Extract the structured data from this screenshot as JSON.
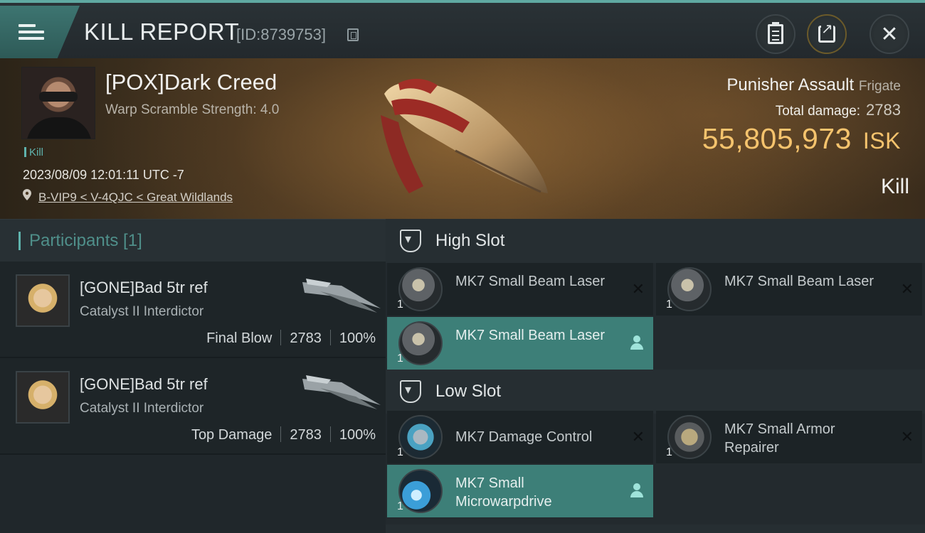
{
  "header": {
    "title": "KILL REPORT",
    "report_id": "[ID:8739753]"
  },
  "victim": {
    "name": "[POX]Dark Creed",
    "warp_scramble": "Warp Scramble Strength: 4.0",
    "tag": "Kill",
    "datetime": "2023/08/09 12:01:11 UTC -7",
    "location": "B-VIP9 < V-4QJC < Great Wildlands",
    "ship_name": "Punisher Assault",
    "ship_class": "Frigate",
    "total_damage_label": "Total damage:",
    "total_damage": "2783",
    "isk_value": "55,805,973",
    "isk_unit": "ISK",
    "result": "Kill"
  },
  "participants": {
    "label": "Participants [1]",
    "items": [
      {
        "name": "[GONE]Bad 5tr ref",
        "ship": "Catalyst II Interdictor",
        "role": "Final Blow",
        "damage": "2783",
        "percent": "100%"
      },
      {
        "name": "[GONE]Bad 5tr ref",
        "ship": "Catalyst II Interdictor",
        "role": "Top Damage",
        "damage": "2783",
        "percent": "100%"
      }
    ]
  },
  "slots": {
    "high": {
      "label": "High Slot",
      "modules": [
        {
          "name": "MK7 Small Beam Laser",
          "qty": "1",
          "state": "destroyed",
          "icon": "beam-laser-icon"
        },
        {
          "name": "MK7 Small Beam Laser",
          "qty": "1",
          "state": "destroyed",
          "icon": "beam-laser-icon"
        },
        {
          "name": "MK7 Small Beam Laser",
          "qty": "1",
          "state": "dropped",
          "icon": "beam-laser-icon"
        }
      ]
    },
    "low": {
      "label": "Low Slot",
      "modules": [
        {
          "name": "MK7 Damage Control",
          "qty": "1",
          "state": "destroyed",
          "icon": "damage-control-icon"
        },
        {
          "name": "MK7 Small Armor Repairer",
          "qty": "1",
          "state": "destroyed",
          "icon": "armor-repairer-icon"
        },
        {
          "name": "MK7 Small Microwarpdrive",
          "qty": "1",
          "state": "dropped",
          "icon": "microwarpdrive-icon"
        }
      ]
    }
  },
  "colors": {
    "accent": "#5fb3ad",
    "isk": "#f5c36d",
    "dropped_bg": "#3d7f78"
  }
}
